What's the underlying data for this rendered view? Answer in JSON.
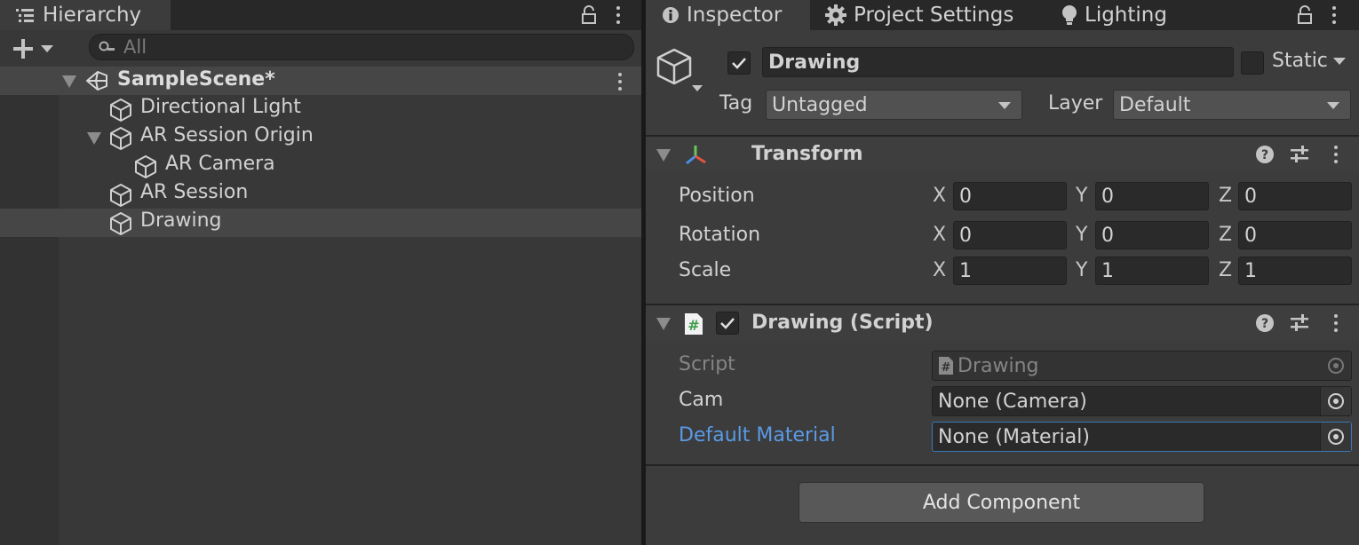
{
  "hierarchy": {
    "tab_label": "Hierarchy",
    "search_placeholder": "All",
    "scene": "SampleScene*",
    "items": [
      {
        "label": "Directional Light"
      },
      {
        "label": "AR Session Origin"
      },
      {
        "label": "AR Camera"
      },
      {
        "label": "AR Session"
      },
      {
        "label": "Drawing"
      }
    ]
  },
  "inspector": {
    "tabs": [
      {
        "label": "Inspector",
        "icon": "info-icon"
      },
      {
        "label": "Project Settings",
        "icon": "gear-icon"
      },
      {
        "label": "Lighting",
        "icon": "bulb-icon"
      }
    ],
    "object_name": "Drawing",
    "static_label": "Static",
    "tag_label": "Tag",
    "tag_value": "Untagged",
    "layer_label": "Layer",
    "layer_value": "Default",
    "transform": {
      "title": "Transform",
      "rows": [
        {
          "label": "Position",
          "x": "0",
          "y": "0",
          "z": "0"
        },
        {
          "label": "Rotation",
          "x": "0",
          "y": "0",
          "z": "0"
        },
        {
          "label": "Scale",
          "x": "1",
          "y": "1",
          "z": "1"
        }
      ],
      "axis_x": "X",
      "axis_y": "Y",
      "axis_z": "Z"
    },
    "script_component": {
      "title": "Drawing (Script)",
      "script_label": "Script",
      "script_value": "Drawing",
      "cam_label": "Cam",
      "cam_value": "None (Camera)",
      "material_label": "Default Material",
      "material_value": "None (Material)"
    },
    "add_component": "Add Component"
  },
  "colors": {
    "panel": "#383838",
    "tabbar": "#282828",
    "selection": "#464646",
    "highlight_label": "#5a9ae6",
    "focus_border": "#3a79bb"
  }
}
